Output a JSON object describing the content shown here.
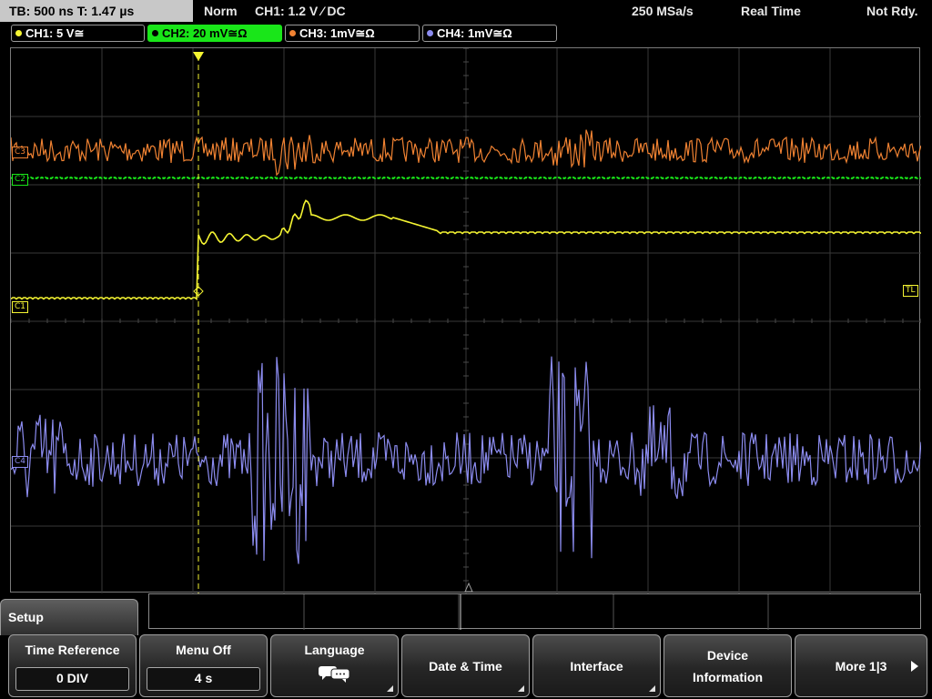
{
  "status_bar": {
    "timebase": "TB: 500 ns   T: 1.47 µs",
    "trigger_mode": "Norm",
    "trigger_info": "CH1: 1.2 V ⁄ DC",
    "sample_rate": "250 MSa/s",
    "acq_mode": "Real Time",
    "status": "Not Rdy."
  },
  "channels": [
    {
      "label": "CH1: 5 V≅",
      "color": "#f5f532",
      "active": false
    },
    {
      "label": "CH2: 20 mV≅Ω",
      "color": "#19e619",
      "active": true
    },
    {
      "label": "CH3: 1mV≅Ω",
      "color": "#f08232",
      "active": false
    },
    {
      "label": "CH4: 1mV≅Ω",
      "color": "#8c8cf0",
      "active": false
    }
  ],
  "markers": {
    "c3": "C3",
    "c2": "C2",
    "c1": "C1",
    "c4": "C4",
    "trigger_level": "TL",
    "trigger_pos": "T"
  },
  "menu": {
    "title": "Setup",
    "softkeys": [
      {
        "label": "Time Reference",
        "value": "0 DIV"
      },
      {
        "label": "Menu Off",
        "value": "4 s"
      },
      {
        "label": "Language",
        "icon": "speech-bubbles-icon"
      },
      {
        "label": "Date & Time"
      },
      {
        "label": "Interface"
      },
      {
        "label": "Device Information"
      },
      {
        "label": "More 1|3"
      }
    ]
  }
}
